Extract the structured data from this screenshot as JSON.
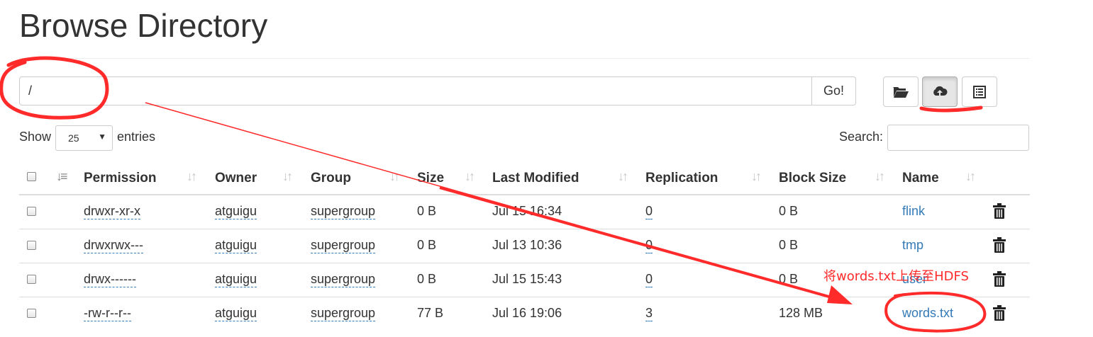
{
  "page": {
    "title": "Browse Directory"
  },
  "toolbar": {
    "path_value": "/",
    "go_label": "Go!",
    "icons": [
      "folder-open-icon",
      "cloud-upload-icon",
      "list-icon"
    ]
  },
  "controls": {
    "show_label": "Show",
    "entries_value": "25",
    "entries_label": "entries",
    "search_label": "Search:"
  },
  "table": {
    "columns": [
      "Permission",
      "Owner",
      "Group",
      "Size",
      "Last Modified",
      "Replication",
      "Block Size",
      "Name"
    ],
    "rows": [
      {
        "permission": "drwxr-xr-x",
        "owner": "atguigu",
        "group": "supergroup",
        "size": "0 B",
        "modified": "Jul 15 16:34",
        "replication": "0",
        "block_size": "0 B",
        "name": "flink"
      },
      {
        "permission": "drwxrwx---",
        "owner": "atguigu",
        "group": "supergroup",
        "size": "0 B",
        "modified": "Jul 13 10:36",
        "replication": "0",
        "block_size": "0 B",
        "name": "tmp"
      },
      {
        "permission": "drwx------",
        "owner": "atguigu",
        "group": "supergroup",
        "size": "0 B",
        "modified": "Jul 15 15:43",
        "replication": "0",
        "block_size": "0 B",
        "name": "user"
      },
      {
        "permission": "-rw-r--r--",
        "owner": "atguigu",
        "group": "supergroup",
        "size": "77 B",
        "modified": "Jul 16 19:06",
        "replication": "3",
        "block_size": "128 MB",
        "name": "words.txt"
      }
    ]
  },
  "annotation": {
    "note": "将words.txt上传至HDFS",
    "color": "#ff2b2b"
  },
  "colors": {
    "link": "#337ab7",
    "text": "#333333",
    "annotation": "#ff2b2b"
  }
}
